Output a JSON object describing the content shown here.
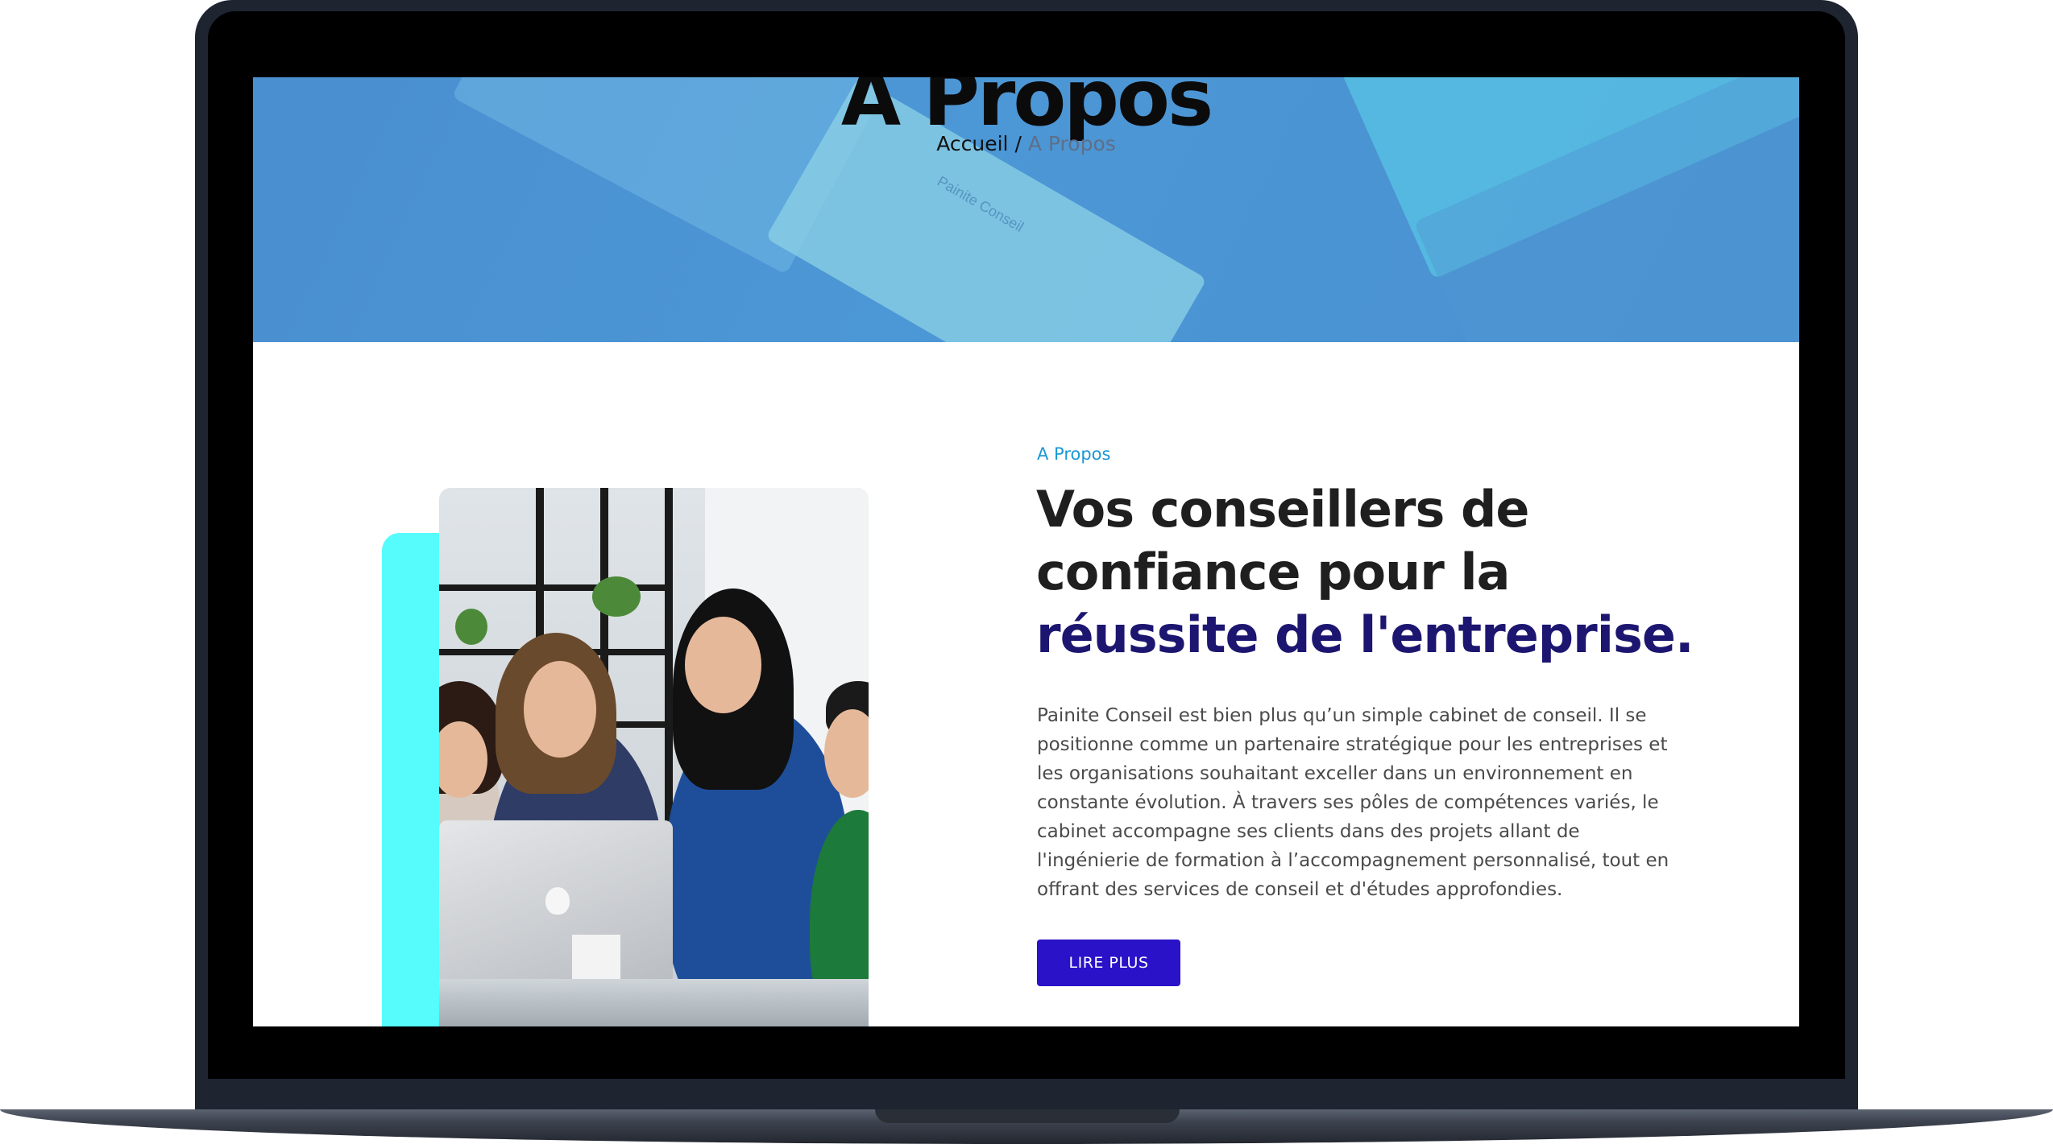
{
  "hero": {
    "title": "A Propos",
    "breadcrumb": {
      "home": "Accueil",
      "separator": "/",
      "current": "A Propos"
    },
    "card_brand": "Painite Conseil"
  },
  "about": {
    "label": "A Propos",
    "heading_line1": "Vos conseillers de",
    "heading_line2": "confiance pour la",
    "heading_highlight": "réussite de l'entreprise.",
    "body": "Painite Conseil est bien plus qu’un simple cabinet de conseil. Il se positionne comme un partenaire stratégique pour les entreprises et les organisations souhaitant exceller dans un environnement en constante évolution. À travers ses pôles de compétences variés, le cabinet accompagne ses clients dans des projets allant de l'ingénierie de formation à l’accompagnement personnalisé, tout en offrant des services de conseil et d'études approfondies.",
    "cta_label": "LIRE PLUS"
  },
  "colors": {
    "hero_blue": "#4a90d0",
    "accent_cyan": "#56fcfc",
    "label_blue": "#1b97d6",
    "highlight_navy": "#1c1670",
    "button": "#2a12c8",
    "breadcrumb_current": "#5e6f88"
  }
}
